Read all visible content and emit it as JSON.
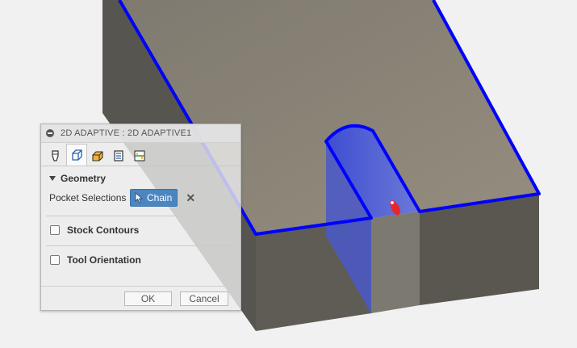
{
  "dialog": {
    "title": "2D ADAPTIVE : 2D ADAPTIVE1",
    "tabs": [
      {
        "icon": "tool-icon"
      },
      {
        "icon": "geometry-icon",
        "active": true
      },
      {
        "icon": "heights-icon"
      },
      {
        "icon": "passes-icon"
      },
      {
        "icon": "linking-icon"
      }
    ],
    "geometry": {
      "heading": "Geometry",
      "pocket_label": "Pocket Selections",
      "chain_label": "Chain",
      "clear_icon": "close-icon"
    },
    "stock_contours_label": "Stock Contours",
    "tool_orientation_label": "Tool Orientation",
    "ok_label": "OK",
    "cancel_label": "Cancel"
  },
  "colors": {
    "selection_edge": "#0000ff",
    "top_face": "#8e877b",
    "side_face": "#5a5750",
    "chain_button": "#4b86c1",
    "marker": "#e8262c"
  }
}
